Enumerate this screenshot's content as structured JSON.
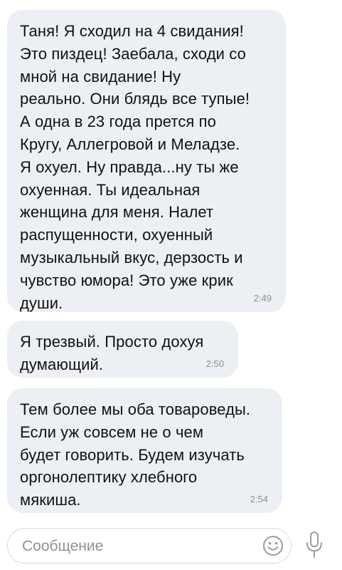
{
  "messages": [
    {
      "text": "Таня! Я сходил на 4 свидания!\nЭто пиздец! Заебала, сходи со\nмной на свидание! Ну\nреально. Они блядь все тупые!\nА одна в 23 года прется по\nКругу, Аллегровой и Меладзе.\nЯ охуел. Ну правда...ну ты же\nохуенная. Ты идеальная\nженщина для меня. Налет\nраспущенности, охуенный\nмузыкальный вкус, дерзость и\nчувство юмора! Это уже крик\nдуши.",
      "time": "2:49"
    },
    {
      "text": "Я трезвый. Просто дохуя\nдумающий.",
      "time": "2:50"
    },
    {
      "text": "Тем более мы оба товароведы.\nЕсли уж совсем не о чем\nбудет говорить. Будем изучать\nоргонолептику хлебного\nмякиша.",
      "time": "2:54"
    }
  ],
  "composer": {
    "placeholder": "Сообщение",
    "emoji_icon": "smiley-icon",
    "mic_icon": "microphone-icon"
  },
  "colors": {
    "bubble": "#eceff3",
    "text": "#111111",
    "time": "#8b8f96",
    "placeholder": "#8e9197",
    "icon": "#9a9da3"
  }
}
